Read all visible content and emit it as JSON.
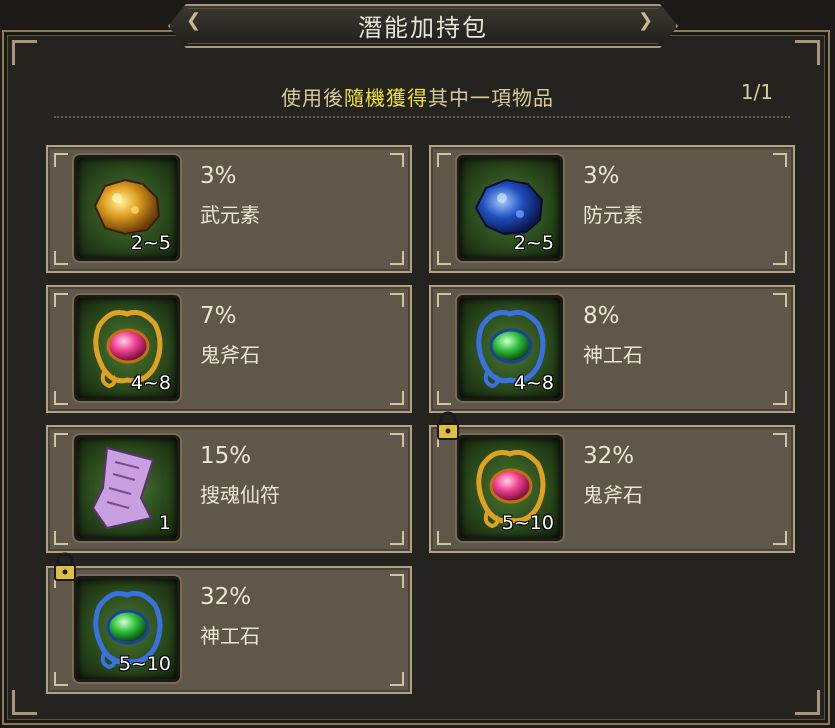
{
  "header": {
    "title": "潛能加持包"
  },
  "info": {
    "prefix": "使用後",
    "highlight": "隨機獲得",
    "suffix": "其中一項物品",
    "pager": "1/1"
  },
  "items": [
    {
      "percent": "3%",
      "name": "武元素",
      "qty": "2~5",
      "icon": "gold-ore-icon",
      "locked": false
    },
    {
      "percent": "3%",
      "name": "防元素",
      "qty": "2~5",
      "icon": "blue-ore-icon",
      "locked": false
    },
    {
      "percent": "7%",
      "name": "鬼斧石",
      "qty": "4~8",
      "icon": "pink-gem-amulet-icon",
      "locked": false
    },
    {
      "percent": "8%",
      "name": "神工石",
      "qty": "4~8",
      "icon": "green-gem-amulet-icon",
      "locked": false
    },
    {
      "percent": "15%",
      "name": "搜魂仙符",
      "qty": "1",
      "icon": "purple-talisman-icon",
      "locked": false
    },
    {
      "percent": "32%",
      "name": "鬼斧石",
      "qty": "5~10",
      "icon": "pink-gem-amulet-icon",
      "locked": true
    },
    {
      "percent": "32%",
      "name": "神工石",
      "qty": "5~10",
      "icon": "green-gem-amulet-icon",
      "locked": true
    }
  ],
  "colors": {
    "highlight": "#f2e238",
    "text": "#d8cc96",
    "card": "#5f5749",
    "frame": "#a8977a"
  }
}
